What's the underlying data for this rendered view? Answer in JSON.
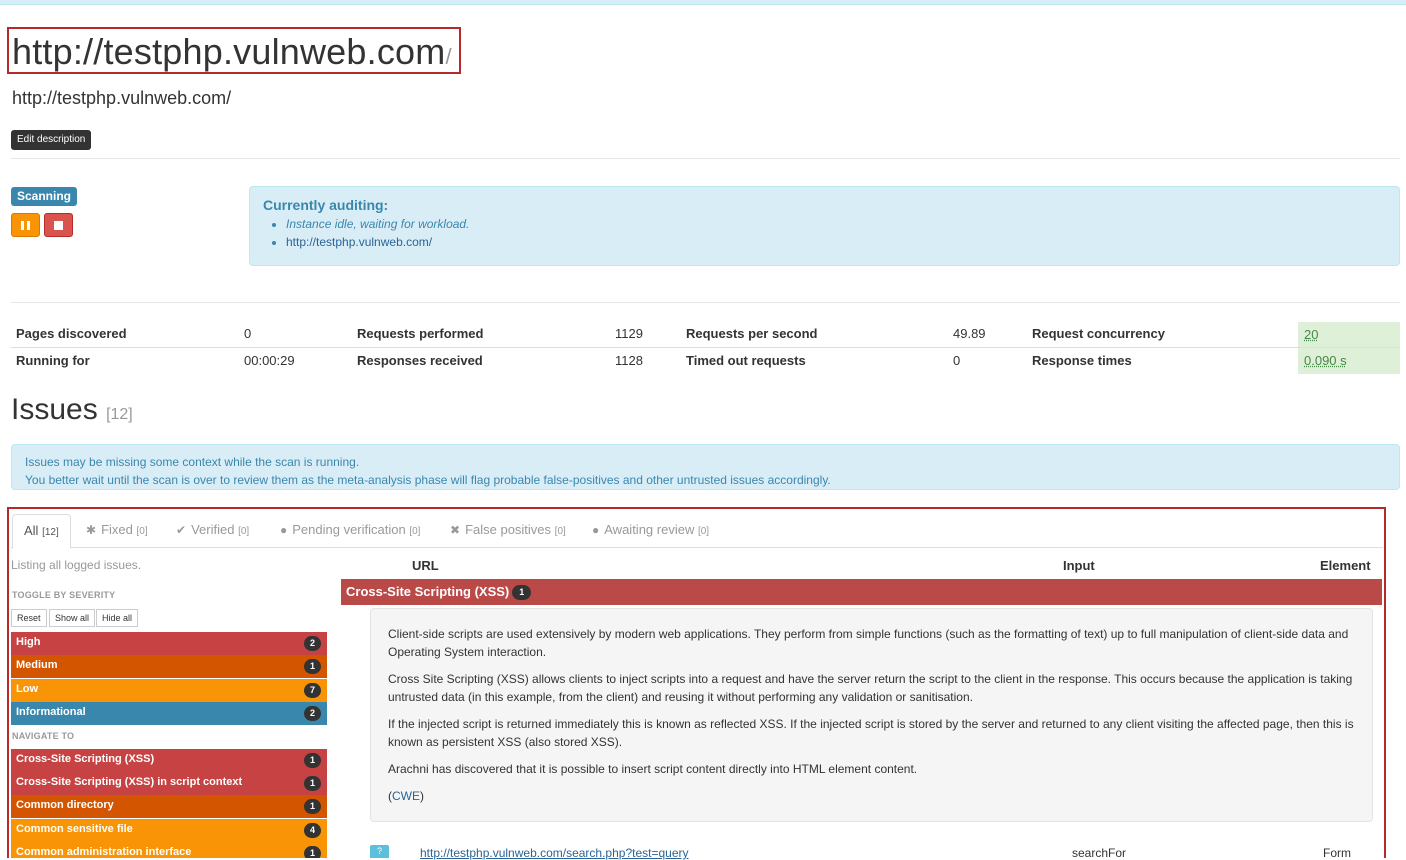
{
  "site": {
    "title": "http://testphp.vulnweb.com",
    "title_slash": "/",
    "subtitle": "http://testphp.vulnweb.com/",
    "edit_button": "Edit description"
  },
  "scan": {
    "status": "Scanning",
    "pause_icon": "pause-icon",
    "stop_icon": "stop-icon",
    "audit_title": "Currently auditing:",
    "audit_items": [
      "Instance idle, waiting for workload.",
      "http://testphp.vulnweb.com/"
    ]
  },
  "stats": {
    "pages_discovered_label": "Pages discovered",
    "pages_discovered": "0",
    "running_for_label": "Running for",
    "running_for": "00:00:29",
    "requests_performed_label": "Requests performed",
    "requests_performed": "1129",
    "responses_received_label": "Responses received",
    "responses_received": "1128",
    "rps_label": "Requests per second",
    "rps": "49.89",
    "timed_out_label": "Timed out requests",
    "timed_out": "0",
    "concurrency_label": "Request concurrency",
    "concurrency": "20",
    "response_times_label": "Response times",
    "response_times": "0.090 s"
  },
  "issues": {
    "heading": "Issues",
    "count": "[12]",
    "warning_line1": "Issues may be missing some context while the scan is running.",
    "warning_line2": "You better wait until the scan is over to review them as the meta-analysis phase will flag probable false-positives and other untrusted issues accordingly.",
    "tabs": [
      {
        "label": "All",
        "count": "[12]",
        "icon": ""
      },
      {
        "label": "Fixed",
        "count": "[0]",
        "icon": "asterisk-icon"
      },
      {
        "label": "Verified",
        "count": "[0]",
        "icon": "check-icon"
      },
      {
        "label": "Pending verification",
        "count": "[0]",
        "icon": "info-icon"
      },
      {
        "label": "False positives",
        "count": "[0]",
        "icon": "x-icon"
      },
      {
        "label": "Awaiting review",
        "count": "[0]",
        "icon": "info-icon"
      }
    ],
    "listing": "Listing all logged issues.",
    "toggle_heading": "TOGGLE BY SEVERITY",
    "buttons": {
      "reset": "Reset",
      "show_all": "Show all",
      "hide_all": "Hide all"
    },
    "severities": [
      {
        "label": "High",
        "count": "2",
        "color": "#c74343"
      },
      {
        "label": "Medium",
        "count": "1",
        "color": "#d45500"
      },
      {
        "label": "Low",
        "count": "7",
        "color": "#f89406"
      },
      {
        "label": "Informational",
        "count": "2",
        "color": "#3a87ad"
      }
    ],
    "navigate_heading": "NAVIGATE TO",
    "navigate": [
      {
        "label": "Cross-Site Scripting (XSS)",
        "count": "1"
      },
      {
        "label": "Cross-Site Scripting (XSS) in script context",
        "count": "1"
      },
      {
        "label": "Common directory",
        "count": "1"
      },
      {
        "label": "Common sensitive file",
        "count": "4"
      },
      {
        "label": "Common administration interface",
        "count": "1"
      }
    ],
    "columns": {
      "url": "URL",
      "input": "Input",
      "element": "Element"
    },
    "group": {
      "title": "Cross-Site Scripting (XSS)",
      "count": "1"
    },
    "description": [
      "Client-side scripts are used extensively by modern web applications. They perform from simple functions (such as the formatting of text) up to full manipulation of client-side data and Operating System interaction.",
      "Cross Site Scripting (XSS) allows clients to inject scripts into a request and have the server return the script to the client in the response. This occurs because the application is taking untrusted data (in this example, from the client) and reusing it without performing any validation or sanitisation.",
      "If the injected script is returned immediately this is known as reflected XSS. If the injected script is stored by the server and returned to any client visiting the affected page, then this is known as persistent XSS (also stored XSS).",
      "Arachni has discovered that it is possible to insert script content directly into HTML element content."
    ],
    "cwe_link": "CWE",
    "row": {
      "url": "http://testphp.vulnweb.com/search.php?test=query",
      "input": "searchFor",
      "element": "Form"
    }
  }
}
